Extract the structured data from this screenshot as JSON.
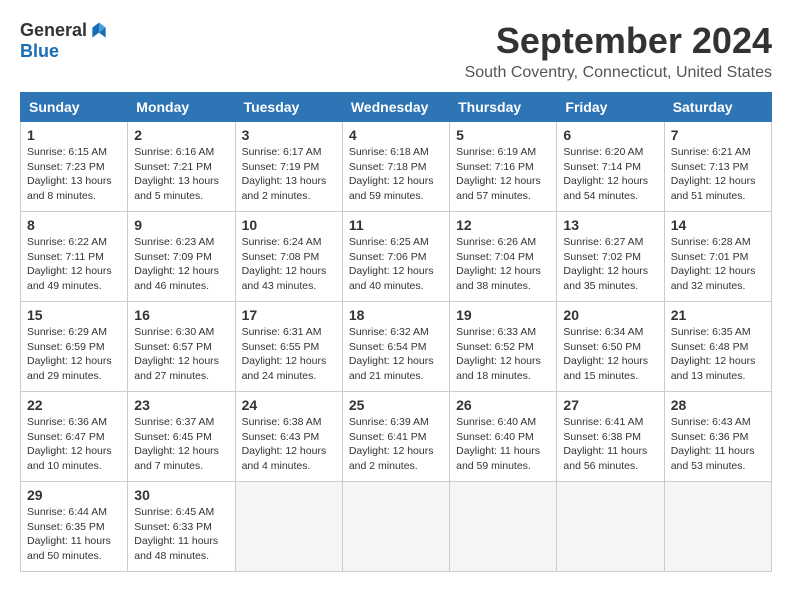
{
  "logo": {
    "general": "General",
    "blue": "Blue"
  },
  "title": "September 2024",
  "location": "South Coventry, Connecticut, United States",
  "days_of_week": [
    "Sunday",
    "Monday",
    "Tuesday",
    "Wednesday",
    "Thursday",
    "Friday",
    "Saturday"
  ],
  "weeks": [
    [
      {
        "day": "1",
        "sunrise": "6:15 AM",
        "sunset": "7:23 PM",
        "daylight": "13 hours and 8 minutes."
      },
      {
        "day": "2",
        "sunrise": "6:16 AM",
        "sunset": "7:21 PM",
        "daylight": "13 hours and 5 minutes."
      },
      {
        "day": "3",
        "sunrise": "6:17 AM",
        "sunset": "7:19 PM",
        "daylight": "13 hours and 2 minutes."
      },
      {
        "day": "4",
        "sunrise": "6:18 AM",
        "sunset": "7:18 PM",
        "daylight": "12 hours and 59 minutes."
      },
      {
        "day": "5",
        "sunrise": "6:19 AM",
        "sunset": "7:16 PM",
        "daylight": "12 hours and 57 minutes."
      },
      {
        "day": "6",
        "sunrise": "6:20 AM",
        "sunset": "7:14 PM",
        "daylight": "12 hours and 54 minutes."
      },
      {
        "day": "7",
        "sunrise": "6:21 AM",
        "sunset": "7:13 PM",
        "daylight": "12 hours and 51 minutes."
      }
    ],
    [
      {
        "day": "8",
        "sunrise": "6:22 AM",
        "sunset": "7:11 PM",
        "daylight": "12 hours and 49 minutes."
      },
      {
        "day": "9",
        "sunrise": "6:23 AM",
        "sunset": "7:09 PM",
        "daylight": "12 hours and 46 minutes."
      },
      {
        "day": "10",
        "sunrise": "6:24 AM",
        "sunset": "7:08 PM",
        "daylight": "12 hours and 43 minutes."
      },
      {
        "day": "11",
        "sunrise": "6:25 AM",
        "sunset": "7:06 PM",
        "daylight": "12 hours and 40 minutes."
      },
      {
        "day": "12",
        "sunrise": "6:26 AM",
        "sunset": "7:04 PM",
        "daylight": "12 hours and 38 minutes."
      },
      {
        "day": "13",
        "sunrise": "6:27 AM",
        "sunset": "7:02 PM",
        "daylight": "12 hours and 35 minutes."
      },
      {
        "day": "14",
        "sunrise": "6:28 AM",
        "sunset": "7:01 PM",
        "daylight": "12 hours and 32 minutes."
      }
    ],
    [
      {
        "day": "15",
        "sunrise": "6:29 AM",
        "sunset": "6:59 PM",
        "daylight": "12 hours and 29 minutes."
      },
      {
        "day": "16",
        "sunrise": "6:30 AM",
        "sunset": "6:57 PM",
        "daylight": "12 hours and 27 minutes."
      },
      {
        "day": "17",
        "sunrise": "6:31 AM",
        "sunset": "6:55 PM",
        "daylight": "12 hours and 24 minutes."
      },
      {
        "day": "18",
        "sunrise": "6:32 AM",
        "sunset": "6:54 PM",
        "daylight": "12 hours and 21 minutes."
      },
      {
        "day": "19",
        "sunrise": "6:33 AM",
        "sunset": "6:52 PM",
        "daylight": "12 hours and 18 minutes."
      },
      {
        "day": "20",
        "sunrise": "6:34 AM",
        "sunset": "6:50 PM",
        "daylight": "12 hours and 15 minutes."
      },
      {
        "day": "21",
        "sunrise": "6:35 AM",
        "sunset": "6:48 PM",
        "daylight": "12 hours and 13 minutes."
      }
    ],
    [
      {
        "day": "22",
        "sunrise": "6:36 AM",
        "sunset": "6:47 PM",
        "daylight": "12 hours and 10 minutes."
      },
      {
        "day": "23",
        "sunrise": "6:37 AM",
        "sunset": "6:45 PM",
        "daylight": "12 hours and 7 minutes."
      },
      {
        "day": "24",
        "sunrise": "6:38 AM",
        "sunset": "6:43 PM",
        "daylight": "12 hours and 4 minutes."
      },
      {
        "day": "25",
        "sunrise": "6:39 AM",
        "sunset": "6:41 PM",
        "daylight": "12 hours and 2 minutes."
      },
      {
        "day": "26",
        "sunrise": "6:40 AM",
        "sunset": "6:40 PM",
        "daylight": "11 hours and 59 minutes."
      },
      {
        "day": "27",
        "sunrise": "6:41 AM",
        "sunset": "6:38 PM",
        "daylight": "11 hours and 56 minutes."
      },
      {
        "day": "28",
        "sunrise": "6:43 AM",
        "sunset": "6:36 PM",
        "daylight": "11 hours and 53 minutes."
      }
    ],
    [
      {
        "day": "29",
        "sunrise": "6:44 AM",
        "sunset": "6:35 PM",
        "daylight": "11 hours and 50 minutes."
      },
      {
        "day": "30",
        "sunrise": "6:45 AM",
        "sunset": "6:33 PM",
        "daylight": "11 hours and 48 minutes."
      },
      null,
      null,
      null,
      null,
      null
    ]
  ]
}
